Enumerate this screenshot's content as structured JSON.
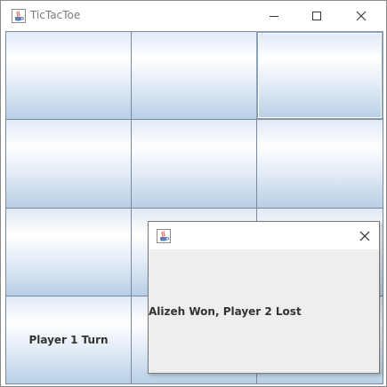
{
  "window": {
    "title": "TicTacToe",
    "controls": [
      "minimize",
      "maximize",
      "close"
    ]
  },
  "board": {
    "cells": [
      "",
      "",
      "",
      "",
      "",
      "",
      "",
      "",
      "",
      "Player 1 Turn",
      "",
      ""
    ],
    "status_label": "Player 1 Turn"
  },
  "dialog": {
    "title": "",
    "message": "Alizeh Won, Player 2 Lost"
  },
  "icons": {
    "app_icon": "java-coffee-icon",
    "minimize": "minimize-icon",
    "maximize": "maximize-icon",
    "close": "close-icon"
  }
}
